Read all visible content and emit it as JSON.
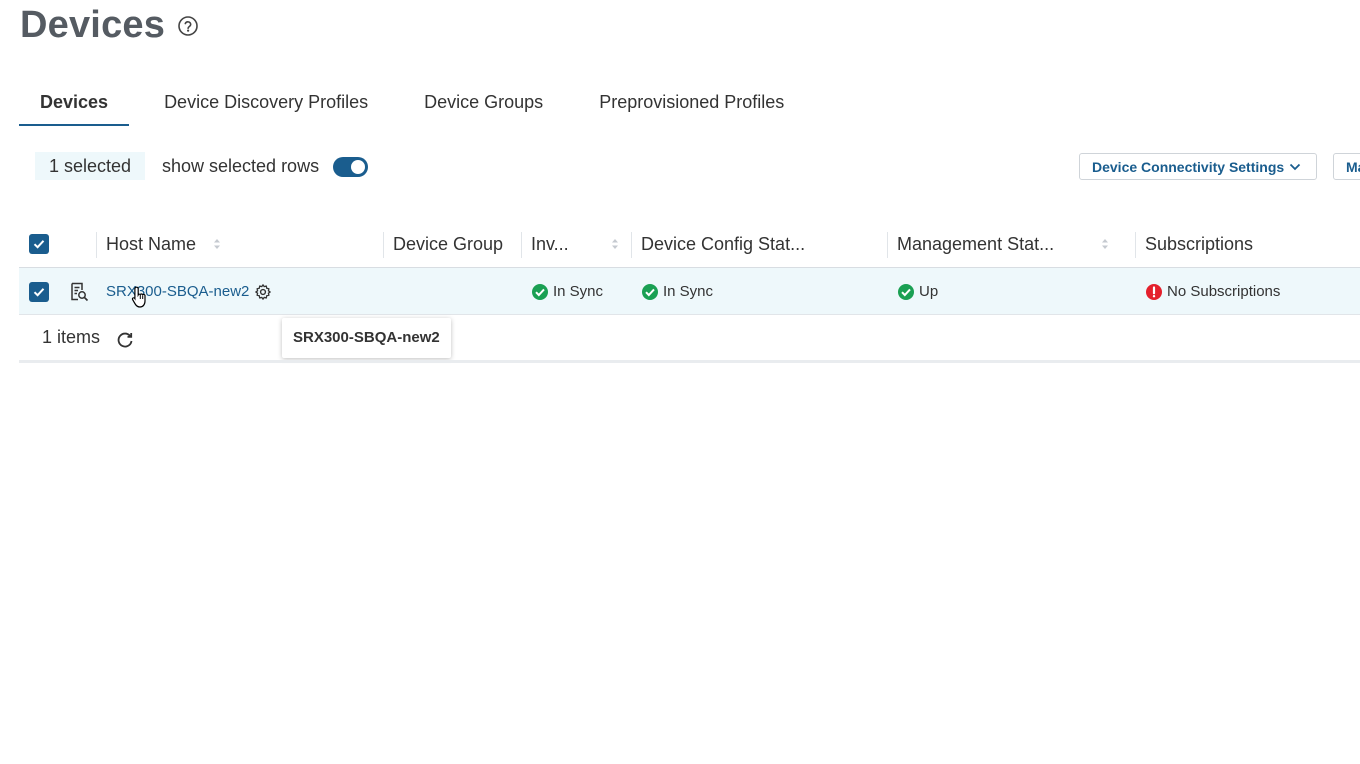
{
  "page": {
    "title": "Devices"
  },
  "tabs": [
    {
      "label": "Devices",
      "active": true
    },
    {
      "label": "Device Discovery Profiles",
      "active": false
    },
    {
      "label": "Device Groups",
      "active": false
    },
    {
      "label": "Preprovisioned Profiles",
      "active": false
    }
  ],
  "toolbar": {
    "selected_label": "1 selected",
    "show_selected_label": "show selected rows",
    "show_selected_on": true,
    "connectivity_button": "Device Connectivity Settings",
    "more_button": "Ma"
  },
  "table": {
    "headers": {
      "host_name": "Host Name",
      "device_group": "Device Group",
      "inventory": "Inv...",
      "config_status": "Device Config Stat...",
      "management_status": "Management Stat...",
      "subscriptions": "Subscriptions"
    },
    "rows": [
      {
        "selected": true,
        "host_name": "SRX300-SBQA-new2",
        "device_group": "",
        "inventory": "In Sync",
        "config_status": "In Sync",
        "management_status": "Up",
        "subscriptions": "No Subscriptions"
      }
    ],
    "tooltip": "SRX300-SBQA-new2",
    "footer_count": "1 items"
  },
  "colors": {
    "accent": "#1a5d8e",
    "selected_row": "#eef8fb",
    "status_ok": "#1aa053",
    "status_error": "#e4202c"
  }
}
